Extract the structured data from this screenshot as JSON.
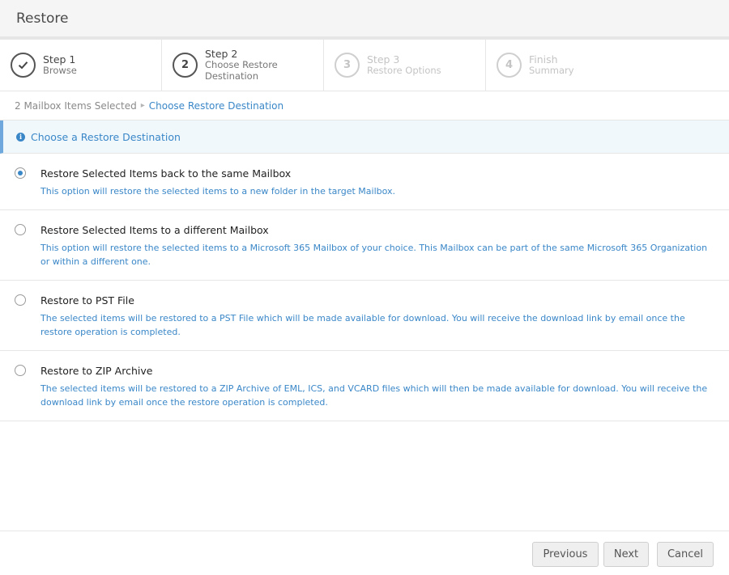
{
  "header": {
    "title": "Restore"
  },
  "wizard": {
    "steps": [
      {
        "title": "Step 1",
        "subtitle": "Browse",
        "indicator": "check-icon",
        "state": "completed"
      },
      {
        "title": "Step 2",
        "subtitle": "Choose Restore Destination",
        "indicator": "2",
        "state": "active"
      },
      {
        "title": "Step 3",
        "subtitle": "Restore Options",
        "indicator": "3",
        "state": "disabled"
      },
      {
        "title": "Finish",
        "subtitle": "Summary",
        "indicator": "4",
        "state": "disabled"
      }
    ]
  },
  "breadcrumb": {
    "first": "2 Mailbox Items Selected",
    "current": "Choose Restore Destination"
  },
  "info": {
    "icon": "info-icon",
    "text": "Choose a Restore Destination"
  },
  "options": [
    {
      "title": "Restore Selected Items back to the same Mailbox",
      "description": "This option will restore the selected items to a new folder in the target Mailbox.",
      "selected": true
    },
    {
      "title": "Restore Selected Items to a different Mailbox",
      "description": "This option will restore the selected items to a Microsoft 365 Mailbox of your choice. This Mailbox can be part of the same Microsoft 365 Organization or within a different one.",
      "selected": false
    },
    {
      "title": "Restore to PST File",
      "description": "The selected items will be restored to a PST File which will be made available for download. You will receive the download link by email once the restore operation is completed.",
      "selected": false
    },
    {
      "title": "Restore to ZIP Archive",
      "description": "The selected items will be restored to a ZIP Archive of EML, ICS, and VCARD files which will then be made available for download. You will receive the download link by email once the restore operation is completed.",
      "selected": false
    }
  ],
  "footer": {
    "previous_label": "Previous",
    "next_label": "Next",
    "cancel_label": "Cancel"
  },
  "colors": {
    "accent": "#3a87c8",
    "info_bg": "#f1f8fc",
    "border": "#e6e6e6"
  }
}
